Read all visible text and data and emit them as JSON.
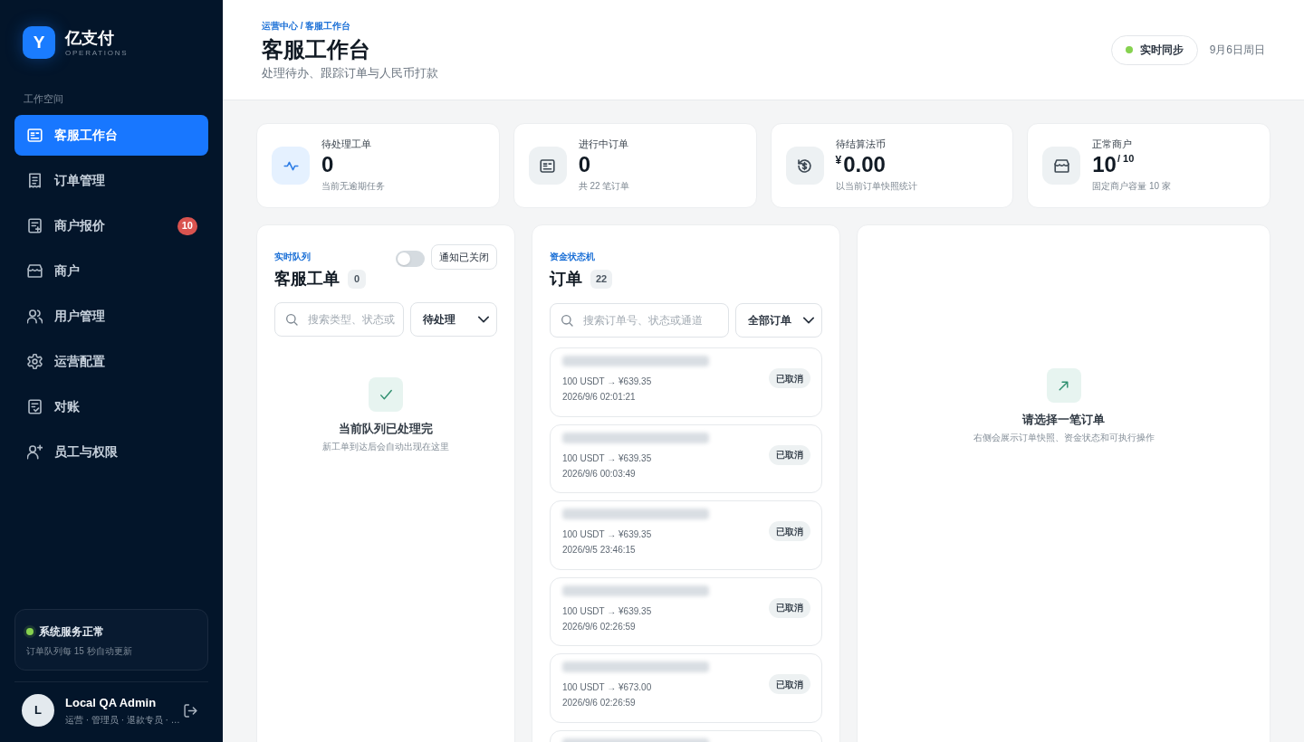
{
  "brand": {
    "logo_letter": "Y",
    "name": "亿支付",
    "tagline": "OPERATIONS"
  },
  "sidebar": {
    "section_label": "工作空间",
    "items": [
      {
        "label": "客服工作台",
        "selected": true
      },
      {
        "label": "订单管理",
        "selected": false
      },
      {
        "label": "商户报价",
        "selected": false,
        "badge": "10"
      },
      {
        "label": "商户",
        "selected": false
      },
      {
        "label": "用户管理",
        "selected": false
      },
      {
        "label": "运营配置",
        "selected": false
      },
      {
        "label": "对账",
        "selected": false
      },
      {
        "label": "员工与权限",
        "selected": false
      }
    ]
  },
  "system_status": {
    "healthy": true,
    "title": "系统服务正常",
    "note": "订单队列每 15 秒自动更新"
  },
  "user": {
    "initial": "L",
    "name": "Local QA Admin",
    "roles": "运营 · 管理员 · 退款专员 · …"
  },
  "header": {
    "breadcrumb": "运营中心 / 客服工作台",
    "title": "客服工作台",
    "subtitle": "处理待办、跟踪订单与人民币打款",
    "sync": {
      "label": "实时同步",
      "live": true
    },
    "date": "9月6日周日"
  },
  "stats": [
    {
      "label": "待处理工单",
      "value": "0",
      "note": "当前无逾期任务",
      "highlighted": true
    },
    {
      "label": "进行中订单",
      "value": "0",
      "note": "共 22 笔订单",
      "highlighted": false
    },
    {
      "label": "待结算法币",
      "prefix": "¥",
      "value": "0.00",
      "note": "以当前订单快照统计",
      "highlighted": false
    },
    {
      "label": "正常商户",
      "value": "10",
      "suffix": "/ 10",
      "note": "固定商户容量 10 家",
      "highlighted": false
    }
  ],
  "tickets": {
    "eyebrow": "实时队列",
    "title": "客服工单",
    "count": "0",
    "notify": {
      "on": false,
      "label": "通知已关闭"
    },
    "search": {
      "placeholder": "搜索类型、状态或"
    },
    "filter": "待处理",
    "empty": {
      "title": "当前队列已处理完",
      "note": "新工单到达后会自动出现在这里"
    }
  },
  "orders": {
    "eyebrow": "资金状态机",
    "title": "订单",
    "count": "22",
    "search": {
      "placeholder": "搜索订单号、状态或通道"
    },
    "filter": "全部订单",
    "items": [
      {
        "redacted": true,
        "amount": "100 USDT → ¥639.35",
        "time": "2026/9/6 02:01:21",
        "status": "已取消"
      },
      {
        "redacted": true,
        "amount": "100 USDT → ¥639.35",
        "time": "2026/9/6 00:03:49",
        "status": "已取消"
      },
      {
        "redacted": true,
        "amount": "100 USDT → ¥639.35",
        "time": "2026/9/5 23:46:15",
        "status": "已取消"
      },
      {
        "redacted": true,
        "amount": "100 USDT → ¥639.35",
        "time": "2026/9/6 02:26:59",
        "status": "已取消"
      },
      {
        "redacted": true,
        "amount": "100 USDT → ¥673.00",
        "time": "2026/9/6 02:26:59",
        "status": "已取消"
      },
      {
        "redacted": true
      }
    ]
  },
  "detail": {
    "title": "请选择一笔订单",
    "note": "右侧会展示订单快照、资金状态和可执行操作"
  }
}
